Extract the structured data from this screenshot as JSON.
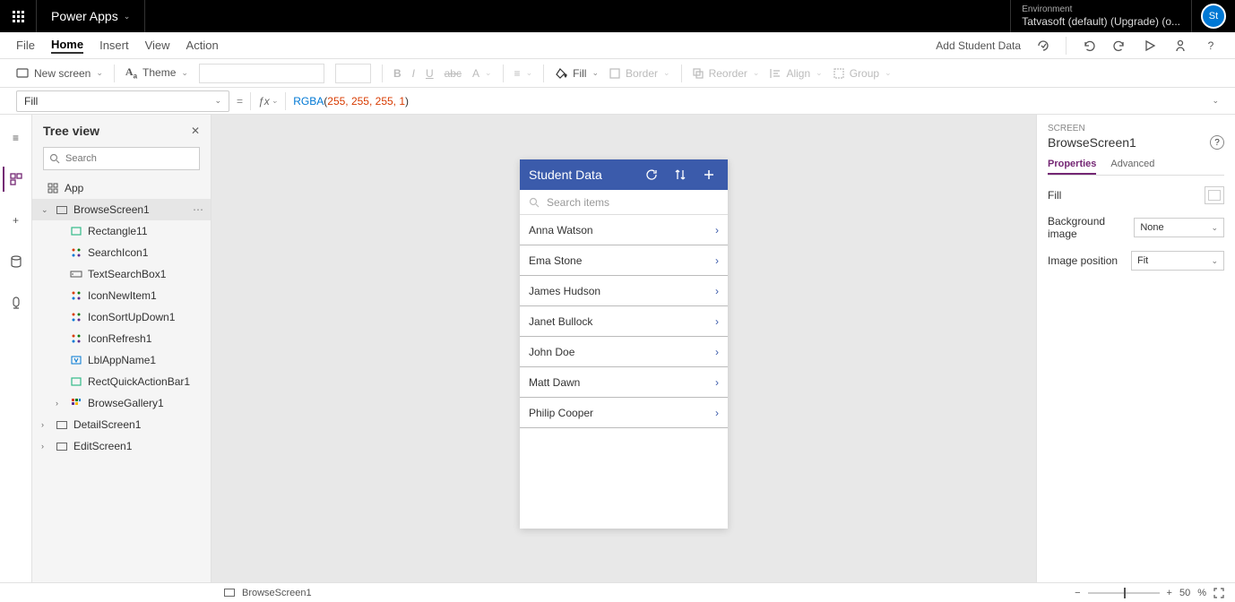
{
  "topbar": {
    "app_title": "Power Apps",
    "env_label": "Environment",
    "env_name": "Tatvasoft (default) (Upgrade) (o...",
    "avatar": "St"
  },
  "menu": {
    "file": "File",
    "home": "Home",
    "insert": "Insert",
    "view": "View",
    "action": "Action",
    "right_label": "Add Student Data"
  },
  "ribbon": {
    "new_screen": "New screen",
    "theme": "Theme",
    "fill": "Fill",
    "border": "Border",
    "reorder": "Reorder",
    "align": "Align",
    "group": "Group"
  },
  "formula": {
    "property": "Fill",
    "fn": "RGBA",
    "args": "255, 255, 255, 1"
  },
  "tree": {
    "title": "Tree view",
    "search_ph": "Search",
    "app": "App",
    "browse": "BrowseScreen1",
    "nodes": {
      "rect": "Rectangle11",
      "searchicon": "SearchIcon1",
      "textsearch": "TextSearchBox1",
      "newitem": "IconNewItem1",
      "sortud": "IconSortUpDown1",
      "refresh": "IconRefresh1",
      "lblapp": "LblAppName1",
      "rectquick": "RectQuickActionBar1",
      "gallery": "BrowseGallery1"
    },
    "detail": "DetailScreen1",
    "edit": "EditScreen1"
  },
  "phone": {
    "title": "Student Data",
    "search_ph": "Search items",
    "items": [
      "Anna Watson",
      "Ema Stone",
      "James Hudson",
      "Janet Bullock",
      "John Doe",
      "Matt Dawn",
      "Philip Cooper"
    ]
  },
  "props": {
    "section": "SCREEN",
    "name": "BrowseScreen1",
    "tab_props": "Properties",
    "tab_adv": "Advanced",
    "fill": "Fill",
    "bgimg": "Background image",
    "bgimg_val": "None",
    "imgpos": "Image position",
    "imgpos_val": "Fit"
  },
  "status": {
    "screen": "BrowseScreen1",
    "zoom": "50",
    "pct": "%"
  }
}
